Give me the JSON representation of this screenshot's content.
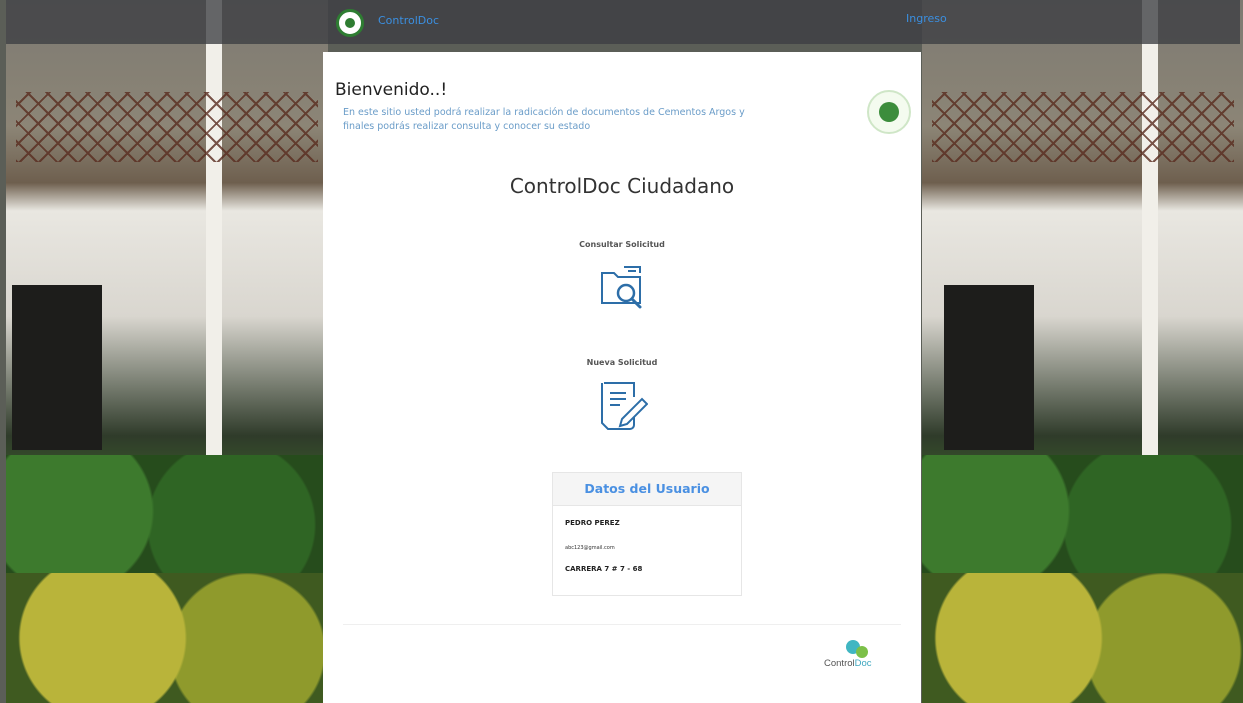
{
  "topbar": {
    "brand_text": "ControlDoc",
    "right_text": "Ingreso"
  },
  "welcome": {
    "title": "Bienvenido..!",
    "intro": "En este sitio usted podrá realizar la radicación de documentos de Cementos Argos y finales podrás realizar consulta y conocer su estado"
  },
  "app_title": "ControlDoc Ciudadano",
  "actions": {
    "consult_label": "Consultar Solicitud",
    "new_label": "Nueva Solicitud"
  },
  "user": {
    "header": "Datos del Usuario",
    "name": "PEDRO PEREZ",
    "email": "abc123@gmail.com",
    "address": "CARRERA 7 # 7 - 68"
  },
  "footer": {
    "logo_text_a": "Control",
    "logo_text_b": "Doc"
  },
  "colors": {
    "link_blue": "#4a90e2",
    "icon_blue": "#2d6ea8"
  }
}
